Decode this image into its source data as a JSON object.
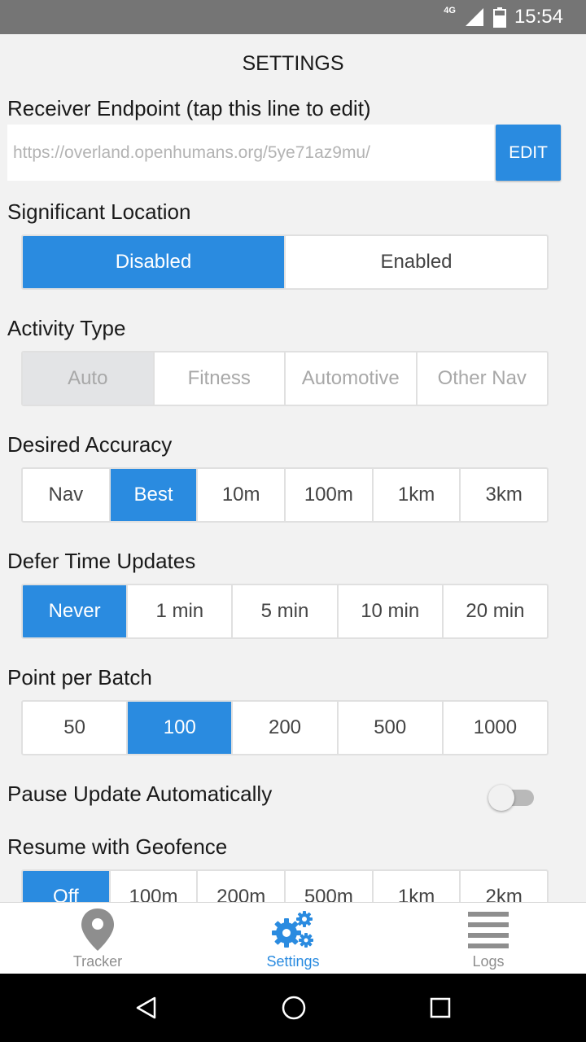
{
  "status_bar": {
    "network": "4G",
    "time": "15:54"
  },
  "header": {
    "title": "SETTINGS"
  },
  "endpoint": {
    "label": "Receiver Endpoint (tap this line to edit)",
    "value": "https://overland.openhumans.org/5ye71az9mu/",
    "edit_label": "EDIT"
  },
  "significant_location": {
    "label": "Significant Location",
    "options": [
      "Disabled",
      "Enabled"
    ],
    "selected": "Disabled"
  },
  "activity_type": {
    "label": "Activity Type",
    "options": [
      "Auto",
      "Fitness",
      "Automotive",
      "Other Nav"
    ],
    "selected": "Auto"
  },
  "desired_accuracy": {
    "label": "Desired Accuracy",
    "options": [
      "Nav",
      "Best",
      "10m",
      "100m",
      "1km",
      "3km"
    ],
    "selected": "Best"
  },
  "defer_time": {
    "label": "Defer Time Updates",
    "options": [
      "Never",
      "1 min",
      "5 min",
      "10 min",
      "20 min"
    ],
    "selected": "Never"
  },
  "points_per_batch": {
    "label": "Point per Batch",
    "options": [
      "50",
      "100",
      "200",
      "500",
      "1000"
    ],
    "selected": "100"
  },
  "pause_update": {
    "label": "Pause Update Automatically",
    "enabled": false
  },
  "resume_geofence": {
    "label": "Resume with Geofence",
    "options": [
      "Off",
      "100m",
      "200m",
      "500m",
      "1km",
      "2km"
    ],
    "selected": "Off"
  },
  "tabs": [
    {
      "label": "Tracker",
      "icon": "location-pin-icon",
      "active": false
    },
    {
      "label": "Settings",
      "icon": "gears-icon",
      "active": true
    },
    {
      "label": "Logs",
      "icon": "list-icon",
      "active": false
    }
  ],
  "colors": {
    "accent": "#2a8be0",
    "disabled_fill": "#e3e4e6"
  }
}
